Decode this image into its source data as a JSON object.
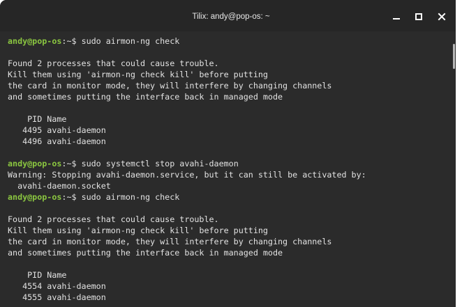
{
  "window": {
    "title": "Tilix: andy@pop-os: ~"
  },
  "controls": {
    "minimize_icon": "minimize-icon",
    "maximize_icon": "maximize-icon",
    "close_icon": "close-icon"
  },
  "colors": {
    "background": "#2b2b2b",
    "titlebar": "#262626",
    "prompt_user": "#8ac540",
    "text": "#e2e2e2"
  },
  "terminal": {
    "lines": [
      {
        "prompt_user": "andy@pop-os",
        "prompt_path": ":~$ ",
        "text": "sudo airmon-ng check"
      },
      {
        "text": ""
      },
      {
        "text": "Found 2 processes that could cause trouble."
      },
      {
        "text": "Kill them using 'airmon-ng check kill' before putting"
      },
      {
        "text": "the card in monitor mode, they will interfere by changing channels"
      },
      {
        "text": "and sometimes putting the interface back in managed mode"
      },
      {
        "text": ""
      },
      {
        "text": "    PID Name"
      },
      {
        "text": "   4495 avahi-daemon"
      },
      {
        "text": "   4496 avahi-daemon"
      },
      {
        "text": ""
      },
      {
        "prompt_user": "andy@pop-os",
        "prompt_path": ":~$ ",
        "text": "sudo systemctl stop avahi-daemon"
      },
      {
        "text": "Warning: Stopping avahi-daemon.service, but it can still be activated by:"
      },
      {
        "text": "  avahi-daemon.socket"
      },
      {
        "prompt_user": "andy@pop-os",
        "prompt_path": ":~$ ",
        "text": "sudo airmon-ng check"
      },
      {
        "text": ""
      },
      {
        "text": "Found 2 processes that could cause trouble."
      },
      {
        "text": "Kill them using 'airmon-ng check kill' before putting"
      },
      {
        "text": "the card in monitor mode, they will interfere by changing channels"
      },
      {
        "text": "and sometimes putting the interface back in managed mode"
      },
      {
        "text": ""
      },
      {
        "text": "    PID Name"
      },
      {
        "text": "   4554 avahi-daemon"
      },
      {
        "text": "   4555 avahi-daemon"
      }
    ]
  }
}
